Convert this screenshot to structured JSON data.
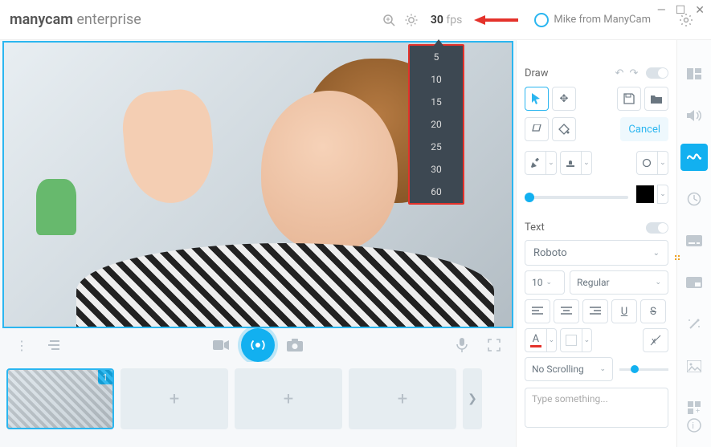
{
  "app": {
    "brand": "manycam",
    "edition": "enterprise"
  },
  "window_controls": {
    "minimize": "—",
    "maximize": "☐",
    "close": "✕"
  },
  "topbar": {
    "fps_value": "30",
    "fps_unit": "fps",
    "user_label": "Mike from ManyCam"
  },
  "fps_options": [
    "5",
    "10",
    "15",
    "20",
    "25",
    "30",
    "60"
  ],
  "video_toolbar": {
    "broadcast": "●"
  },
  "thumbs": {
    "active_badge": "1"
  },
  "draw": {
    "title": "Draw",
    "cancel": "Cancel"
  },
  "text": {
    "title": "Text",
    "font": "Roboto",
    "size": "10",
    "weight": "Regular",
    "scrolling": "No Scrolling",
    "placeholder": "Type something..."
  },
  "sidebar_right": {
    "presets": "presets-icon",
    "audio": "speaker-icon",
    "draw": "scribble-icon",
    "time": "clock-icon",
    "subtitle": "subtitle-icon",
    "overlay": "overlay-icon",
    "effects": "wand-icon",
    "image": "image-icon",
    "apps": "apps-icon",
    "help": "help-icon"
  }
}
